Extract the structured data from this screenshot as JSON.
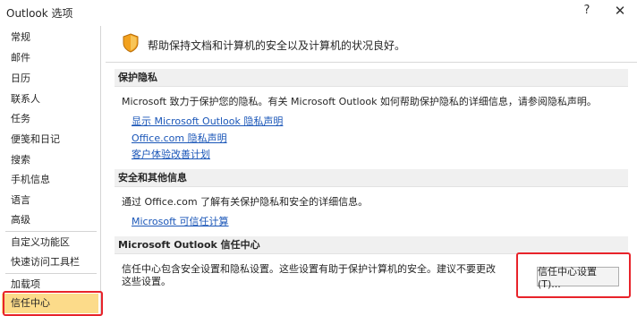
{
  "window": {
    "title": "Outlook 选项",
    "help_label": "?",
    "close_label": "✕"
  },
  "sidebar": {
    "items": [
      {
        "label": "常规"
      },
      {
        "label": "邮件"
      },
      {
        "label": "日历"
      },
      {
        "label": "联系人"
      },
      {
        "label": "任务"
      },
      {
        "label": "便笺和日记"
      },
      {
        "label": "搜索"
      },
      {
        "label": "手机信息"
      },
      {
        "label": "语言"
      },
      {
        "label": "高级"
      },
      {
        "label": "自定义功能区"
      },
      {
        "label": "快速访问工具栏"
      },
      {
        "label": "加载项"
      },
      {
        "label": "信任中心",
        "selected": true
      }
    ]
  },
  "main": {
    "banner": {
      "icon": "shield-icon",
      "text": "帮助保持文档和计算机的安全以及计算机的状况良好。"
    },
    "privacy": {
      "heading": "保护隐私",
      "text": "Microsoft 致力于保护您的隐私。有关 Microsoft Outlook 如何帮助保护隐私的详细信息，请参阅隐私声明。",
      "links": [
        "显示 Microsoft Outlook 隐私声明",
        "Office.com 隐私声明",
        "客户体验改善计划"
      ]
    },
    "security": {
      "heading": "安全和其他信息",
      "text": "通过 Office.com 了解有关保护隐私和安全的详细信息。",
      "links": [
        "Microsoft 可信任计算"
      ]
    },
    "trust_center": {
      "heading": "Microsoft Outlook 信任中心",
      "text_line1": "信任中心包含安全设置和隐私设置。这些设置有助于保护计算机的安全。建议不要更改",
      "text_line2": "这些设置。",
      "button_label": "信任中心设置(T)..."
    }
  },
  "colors": {
    "accent_selected": "#fcdb8a",
    "highlight_border": "#e8232a",
    "link": "#1a56b8",
    "shield_orange": "#f2a11e"
  }
}
